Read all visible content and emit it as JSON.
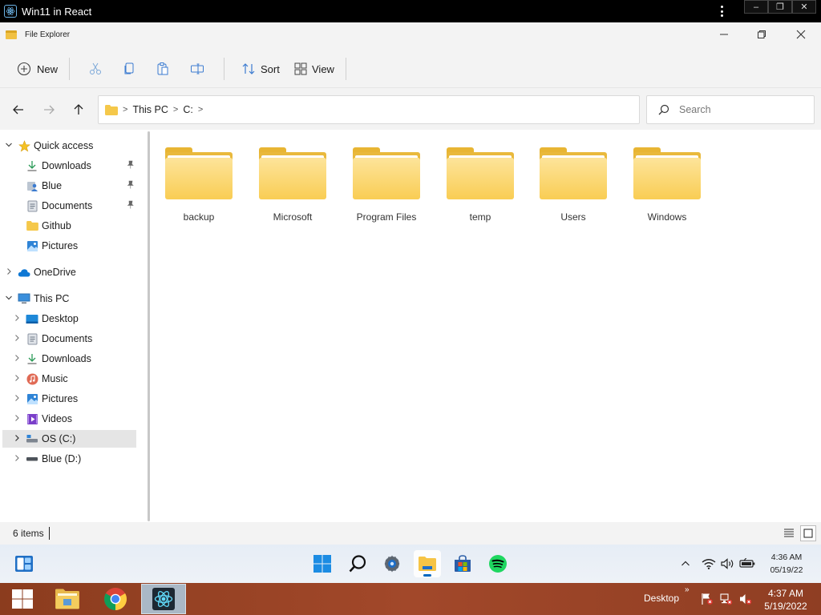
{
  "host": {
    "title": "Win11 in React",
    "controls": [
      "–",
      "❐",
      "✕"
    ]
  },
  "window": {
    "title": "File Explorer"
  },
  "toolbar": {
    "new_label": "New",
    "sort_label": "Sort",
    "view_label": "View"
  },
  "address": {
    "crumbs": [
      "This PC",
      "C:"
    ],
    "search_placeholder": "Search"
  },
  "sidebar": {
    "quick_access": "Quick access",
    "quick_items": [
      "Downloads",
      "Blue",
      "Documents",
      "Github",
      "Pictures"
    ],
    "onedrive": "OneDrive",
    "this_pc": "This PC",
    "pc_items": [
      "Desktop",
      "Documents",
      "Downloads",
      "Music",
      "Pictures",
      "Videos",
      "OS (C:)",
      "Blue (D:)"
    ],
    "selected": "OS (C:)"
  },
  "folders": [
    "backup",
    "Microsoft",
    "Program Files",
    "temp",
    "Users",
    "Windows"
  ],
  "status": {
    "item_count": "6 items"
  },
  "taskbar": {
    "time": "4:36 AM",
    "date": "05/19/22"
  },
  "host_taskbar": {
    "desktop_label": "Desktop",
    "chevron": "»",
    "time": "4:37 AM",
    "date": "5/19/2022"
  },
  "colors": {
    "accent": "#0067c0",
    "folder": "#f9cd54",
    "host_taskbar": "#a2482a"
  }
}
